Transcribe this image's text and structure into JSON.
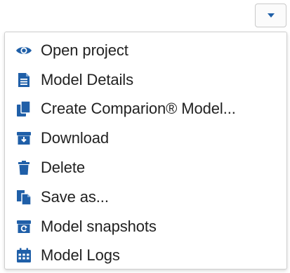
{
  "accent_color": "#1f5fa8",
  "toggle": {
    "icon": "caret-down-icon"
  },
  "menu": {
    "items": [
      {
        "label": "Open project",
        "icon": "eye-icon"
      },
      {
        "label": "Model Details",
        "icon": "document-icon"
      },
      {
        "label": "Create Comparion® Model...",
        "icon": "copy-icon"
      },
      {
        "label": "Download",
        "icon": "download-box-icon"
      },
      {
        "label": "Delete",
        "icon": "trash-icon"
      },
      {
        "label": "Save as...",
        "icon": "save-copy-icon"
      },
      {
        "label": "Model snapshots",
        "icon": "snapshot-icon"
      },
      {
        "label": "Model Logs",
        "icon": "calendar-icon"
      }
    ]
  }
}
